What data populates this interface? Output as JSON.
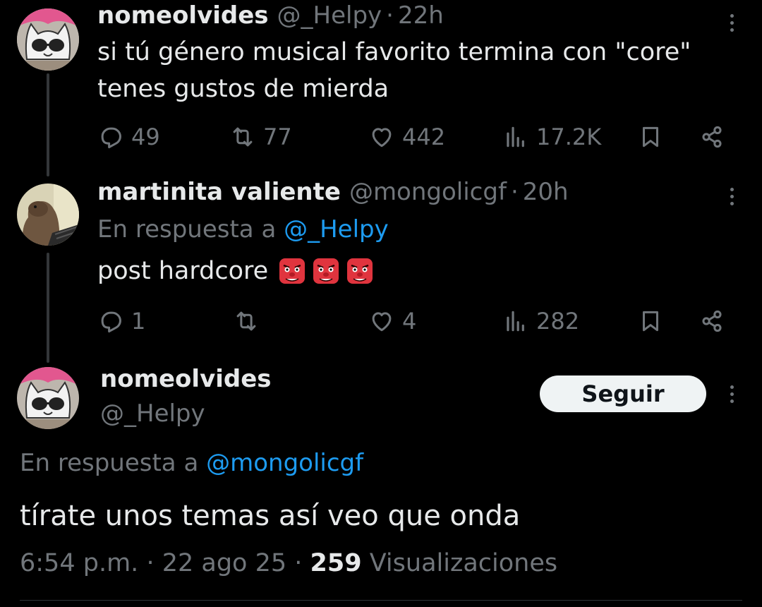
{
  "tweet1": {
    "name": "nomeolvides",
    "handle": "@_Helpy",
    "sep": "·",
    "time": "22h",
    "text_line1": "si tú género musical favorito termina con \"core\"",
    "text_line2": "tenes gustos de mierda",
    "replies": "49",
    "retweets": "77",
    "likes": "442",
    "views": "17.2K"
  },
  "tweet2": {
    "name": "martinita valiente",
    "handle": "@mongolicgf",
    "sep": "·",
    "time": "20h",
    "reply_prefix": "En respuesta a ",
    "reply_mention": "@_Helpy",
    "text": "post hardcore",
    "replies": "1",
    "retweets": "",
    "likes": "4",
    "views": "282"
  },
  "main_tweet": {
    "name": "nomeolvides",
    "handle": "@_Helpy",
    "follow_label": "Seguir",
    "reply_prefix": "En respuesta a ",
    "reply_mention": "@mongolicgf",
    "text": "tírate unos temas así veo que onda",
    "time": "6:54 p.m.",
    "sep": "·",
    "date": "22 ago 25",
    "views_count": "259",
    "views_label": "Visualizaciones"
  },
  "icons": {
    "reply": "reply-icon",
    "retweet": "retweet-icon",
    "like": "heart-icon",
    "views": "views-icon",
    "bookmark": "bookmark-icon",
    "share": "share-icon",
    "more": "more-icon",
    "emoji": "goblin-emoji"
  },
  "colors": {
    "background": "#000000",
    "text": "#e7e9ea",
    "secondary": "#71767b",
    "link": "#1d9bf0"
  }
}
